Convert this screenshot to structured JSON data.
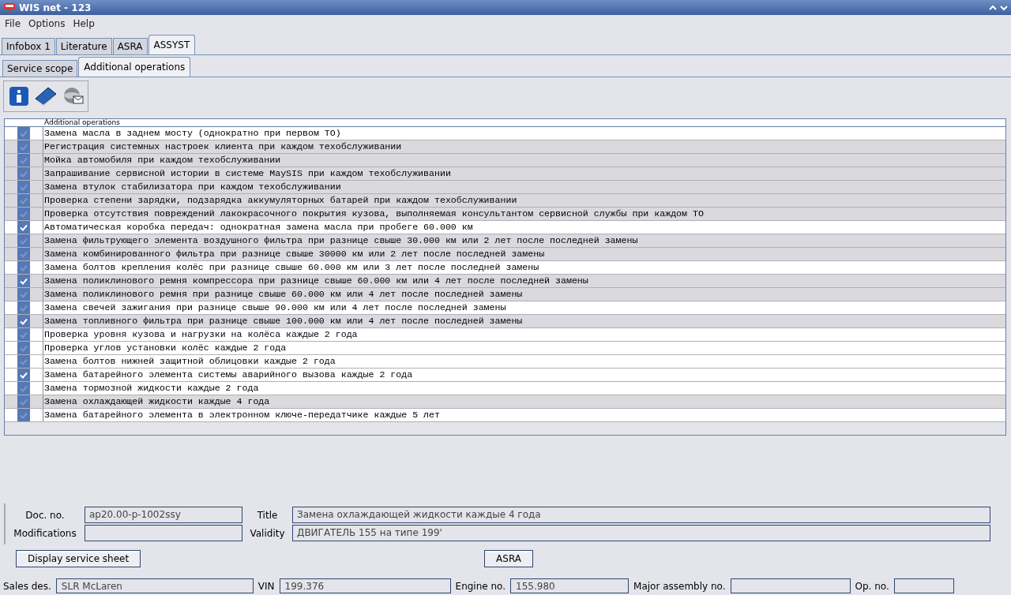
{
  "window": {
    "title": "WIS net - 123"
  },
  "menu": [
    "File",
    "Options",
    "Help"
  ],
  "tabs": [
    {
      "label": "Infobox 1",
      "selected": false
    },
    {
      "label": "Literature",
      "selected": false
    },
    {
      "label": "ASRA",
      "selected": false
    },
    {
      "label": "ASSYST",
      "selected": true
    }
  ],
  "subtabs": [
    {
      "label": "Service scope",
      "selected": false
    },
    {
      "label": "Additional operations",
      "selected": true
    }
  ],
  "table": {
    "column_header": "Additional operations",
    "rows": [
      {
        "text": "Замена масла в заднем мосту (однократно при первом ТО)",
        "checked": false,
        "selected": false
      },
      {
        "text": "Регистрация системных настроек клиента при каждом техобслуживании",
        "checked": false,
        "selected": true
      },
      {
        "text": "Мойка автомобиля при каждом техобслуживании",
        "checked": false,
        "selected": true
      },
      {
        "text": "Запрашивание сервисной истории в системе MaySIS при каждом техобслуживании",
        "checked": false,
        "selected": true
      },
      {
        "text": "Замена втулок стабилизатора при каждом техобслуживании",
        "checked": false,
        "selected": true
      },
      {
        "text": "Проверка степени зарядки, подзарядка аккумуляторных батарей при каждом техобслуживании",
        "checked": false,
        "selected": true
      },
      {
        "text": "Проверка отсутствия повреждений лакокрасочного покрытия кузова, выполняемая консультантом сервисной службы при каждом ТО",
        "checked": false,
        "selected": true
      },
      {
        "text": "Автоматическая коробка передач: однократная замена масла при пробеге 60.000 км",
        "checked": true,
        "selected": false
      },
      {
        "text": "Замена фильтрующего элемента воздушного фильтра при разнице свыше 30.000 км или 2 лет после последней замены",
        "checked": false,
        "selected": true
      },
      {
        "text": "Замена комбинированного фильтра при разнице свыше 30000 км или 2 лет после последней замены",
        "checked": false,
        "selected": true
      },
      {
        "text": "Замена болтов крепления колёс при разнице свыше 60.000 км или 3 лет после последней замены",
        "checked": false,
        "selected": false
      },
      {
        "text": "Замена поликлинового ремня компрессора при разнице свыше 60.000 км или 4 лет после последней замены",
        "checked": true,
        "selected": true
      },
      {
        "text": "Замена поликлинового ремня при разнице свыше 60.000 км или 4 лет после последней замены",
        "checked": false,
        "selected": true
      },
      {
        "text": "Замена свечей зажигания при разнице свыше 90.000 км или 4 лет после последней замены",
        "checked": false,
        "selected": false
      },
      {
        "text": "Замена топливного фильтра при разнице свыше 100.000 км или 4 лет после последней замены",
        "checked": true,
        "selected": true
      },
      {
        "text": "Проверка уровня кузова и нагрузки на колёса каждые 2 года",
        "checked": false,
        "selected": false
      },
      {
        "text": "Проверка углов установки колёс каждые 2 года",
        "checked": false,
        "selected": false
      },
      {
        "text": "Замена болтов нижней защитной облицовки каждые 2 года",
        "checked": false,
        "selected": false
      },
      {
        "text": "Замена батарейного элемента системы аварийного вызова каждые 2 года",
        "checked": true,
        "selected": false
      },
      {
        "text": "Замена тормозной жидкости каждые 2 года",
        "checked": false,
        "selected": false
      },
      {
        "text": "Замена охлаждающей жидкости каждые 4 года",
        "checked": false,
        "selected": true
      },
      {
        "text": "Замена батарейного элемента в электронном ключе-передатчике каждые 5 лет",
        "checked": false,
        "selected": false
      }
    ]
  },
  "details": {
    "doc_no_label": "Doc. no.",
    "doc_no": "ap20.00-p-1002ssy",
    "modifications_label": "Modifications",
    "title_label": "Title",
    "title": "Замена охлаждающей жидкости каждые 4 года",
    "validity_label": "Validity",
    "validity": "ДВИГАТЕЛЬ 155 на типе 199'"
  },
  "buttons": [
    "Display service sheet",
    "ASRA"
  ],
  "status_bar": [
    {
      "label": "Sales des.",
      "value": "SLR McLaren"
    },
    {
      "label": "VIN",
      "value": "199.376"
    },
    {
      "label": "Engine no.",
      "value": "155.980"
    },
    {
      "label": "Major assembly no."
    },
    {
      "label": "Op. no."
    }
  ]
}
